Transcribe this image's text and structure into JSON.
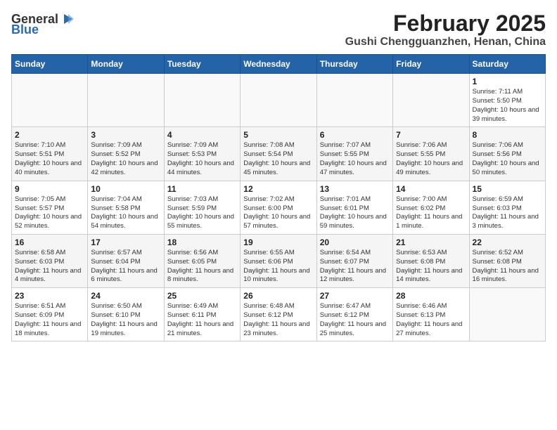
{
  "header": {
    "logo_general": "General",
    "logo_blue": "Blue",
    "month": "February 2025",
    "location": "Gushi Chengguanzhen, Henan, China"
  },
  "weekdays": [
    "Sunday",
    "Monday",
    "Tuesday",
    "Wednesday",
    "Thursday",
    "Friday",
    "Saturday"
  ],
  "weeks": [
    [
      {
        "day": "",
        "info": ""
      },
      {
        "day": "",
        "info": ""
      },
      {
        "day": "",
        "info": ""
      },
      {
        "day": "",
        "info": ""
      },
      {
        "day": "",
        "info": ""
      },
      {
        "day": "",
        "info": ""
      },
      {
        "day": "1",
        "info": "Sunrise: 7:11 AM\nSunset: 5:50 PM\nDaylight: 10 hours and 39 minutes."
      }
    ],
    [
      {
        "day": "2",
        "info": "Sunrise: 7:10 AM\nSunset: 5:51 PM\nDaylight: 10 hours and 40 minutes."
      },
      {
        "day": "3",
        "info": "Sunrise: 7:09 AM\nSunset: 5:52 PM\nDaylight: 10 hours and 42 minutes."
      },
      {
        "day": "4",
        "info": "Sunrise: 7:09 AM\nSunset: 5:53 PM\nDaylight: 10 hours and 44 minutes."
      },
      {
        "day": "5",
        "info": "Sunrise: 7:08 AM\nSunset: 5:54 PM\nDaylight: 10 hours and 45 minutes."
      },
      {
        "day": "6",
        "info": "Sunrise: 7:07 AM\nSunset: 5:55 PM\nDaylight: 10 hours and 47 minutes."
      },
      {
        "day": "7",
        "info": "Sunrise: 7:06 AM\nSunset: 5:55 PM\nDaylight: 10 hours and 49 minutes."
      },
      {
        "day": "8",
        "info": "Sunrise: 7:06 AM\nSunset: 5:56 PM\nDaylight: 10 hours and 50 minutes."
      }
    ],
    [
      {
        "day": "9",
        "info": "Sunrise: 7:05 AM\nSunset: 5:57 PM\nDaylight: 10 hours and 52 minutes."
      },
      {
        "day": "10",
        "info": "Sunrise: 7:04 AM\nSunset: 5:58 PM\nDaylight: 10 hours and 54 minutes."
      },
      {
        "day": "11",
        "info": "Sunrise: 7:03 AM\nSunset: 5:59 PM\nDaylight: 10 hours and 55 minutes."
      },
      {
        "day": "12",
        "info": "Sunrise: 7:02 AM\nSunset: 6:00 PM\nDaylight: 10 hours and 57 minutes."
      },
      {
        "day": "13",
        "info": "Sunrise: 7:01 AM\nSunset: 6:01 PM\nDaylight: 10 hours and 59 minutes."
      },
      {
        "day": "14",
        "info": "Sunrise: 7:00 AM\nSunset: 6:02 PM\nDaylight: 11 hours and 1 minute."
      },
      {
        "day": "15",
        "info": "Sunrise: 6:59 AM\nSunset: 6:03 PM\nDaylight: 11 hours and 3 minutes."
      }
    ],
    [
      {
        "day": "16",
        "info": "Sunrise: 6:58 AM\nSunset: 6:03 PM\nDaylight: 11 hours and 4 minutes."
      },
      {
        "day": "17",
        "info": "Sunrise: 6:57 AM\nSunset: 6:04 PM\nDaylight: 11 hours and 6 minutes."
      },
      {
        "day": "18",
        "info": "Sunrise: 6:56 AM\nSunset: 6:05 PM\nDaylight: 11 hours and 8 minutes."
      },
      {
        "day": "19",
        "info": "Sunrise: 6:55 AM\nSunset: 6:06 PM\nDaylight: 11 hours and 10 minutes."
      },
      {
        "day": "20",
        "info": "Sunrise: 6:54 AM\nSunset: 6:07 PM\nDaylight: 11 hours and 12 minutes."
      },
      {
        "day": "21",
        "info": "Sunrise: 6:53 AM\nSunset: 6:08 PM\nDaylight: 11 hours and 14 minutes."
      },
      {
        "day": "22",
        "info": "Sunrise: 6:52 AM\nSunset: 6:08 PM\nDaylight: 11 hours and 16 minutes."
      }
    ],
    [
      {
        "day": "23",
        "info": "Sunrise: 6:51 AM\nSunset: 6:09 PM\nDaylight: 11 hours and 18 minutes."
      },
      {
        "day": "24",
        "info": "Sunrise: 6:50 AM\nSunset: 6:10 PM\nDaylight: 11 hours and 19 minutes."
      },
      {
        "day": "25",
        "info": "Sunrise: 6:49 AM\nSunset: 6:11 PM\nDaylight: 11 hours and 21 minutes."
      },
      {
        "day": "26",
        "info": "Sunrise: 6:48 AM\nSunset: 6:12 PM\nDaylight: 11 hours and 23 minutes."
      },
      {
        "day": "27",
        "info": "Sunrise: 6:47 AM\nSunset: 6:12 PM\nDaylight: 11 hours and 25 minutes."
      },
      {
        "day": "28",
        "info": "Sunrise: 6:46 AM\nSunset: 6:13 PM\nDaylight: 11 hours and 27 minutes."
      },
      {
        "day": "",
        "info": ""
      }
    ]
  ]
}
